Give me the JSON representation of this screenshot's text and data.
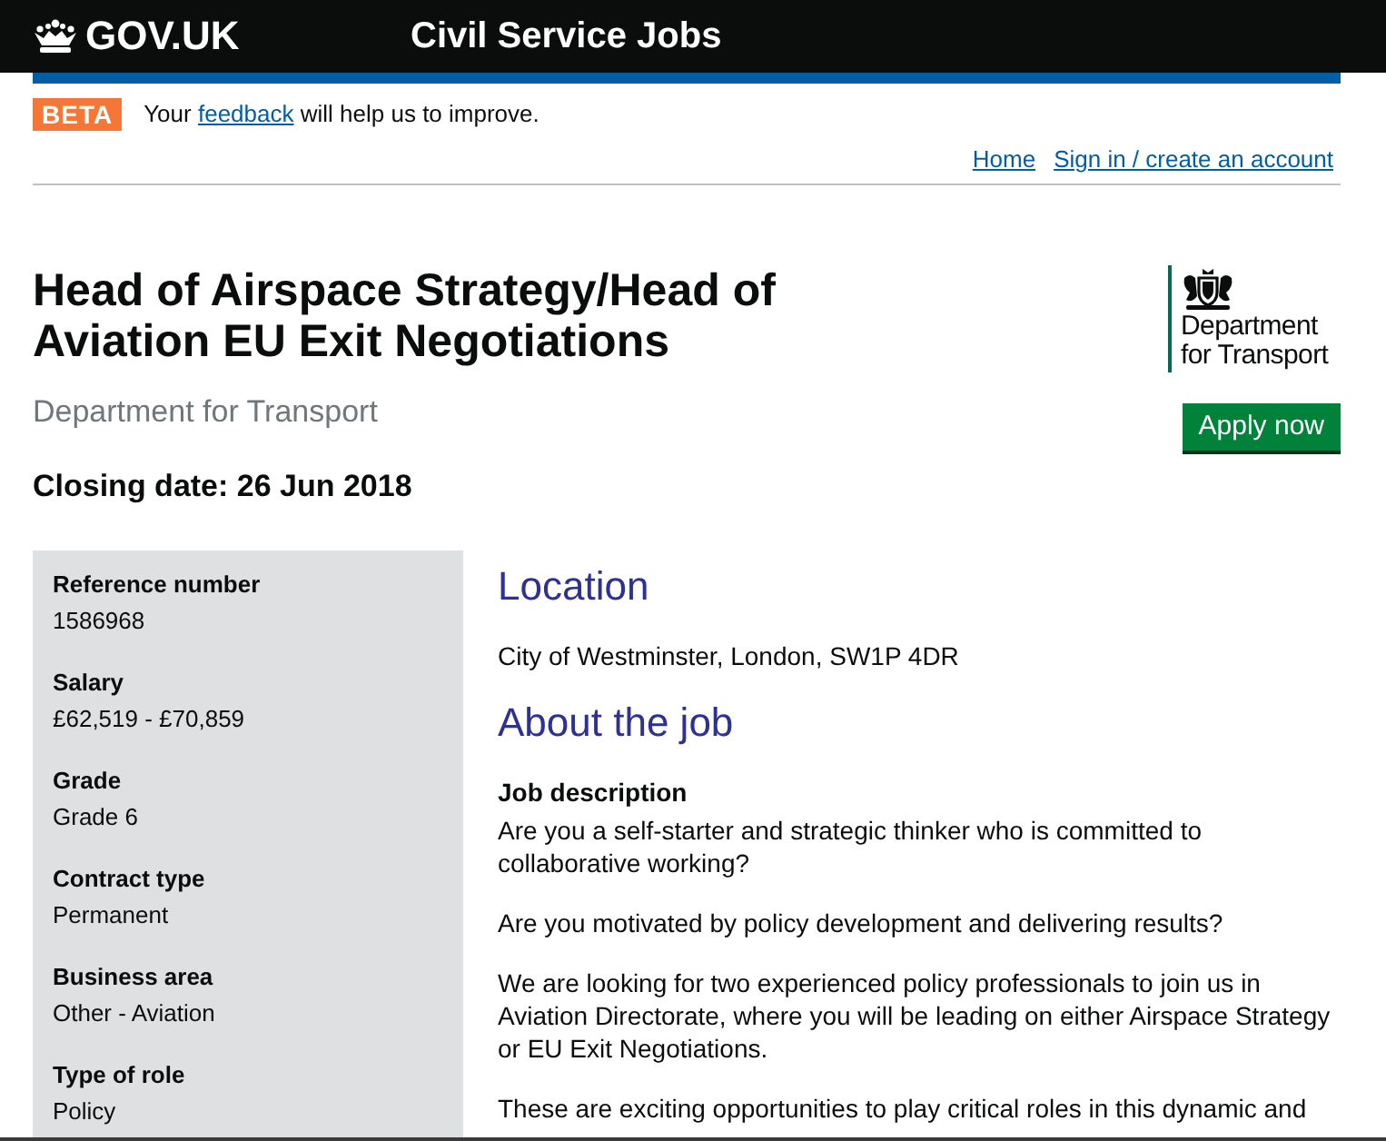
{
  "header": {
    "logo_text": "GOV.UK",
    "service_name": "Civil Service Jobs"
  },
  "phase_banner": {
    "tag": "BETA",
    "text_before": "Your",
    "link": "feedback",
    "text_after": "will help us to improve."
  },
  "nav_links": [
    {
      "label": "Home"
    },
    {
      "label": "Sign in / create an account"
    }
  ],
  "job": {
    "title": "Head of Airspace Strategy/Head of Aviation EU Exit Negotiations",
    "department": "Department for Transport",
    "closing_date": "Closing date: 26 Jun 2018"
  },
  "department_logo": {
    "lines": [
      "Department",
      "for Transport"
    ]
  },
  "apply_button": "Apply now",
  "summary": [
    {
      "label": "Reference number",
      "value": "1586968"
    },
    {
      "label": "Salary",
      "value": "£62,519 - £70,859"
    },
    {
      "label": "Grade",
      "value": "Grade 6"
    },
    {
      "label": "Contract type",
      "value": "Permanent"
    },
    {
      "label": "Business area",
      "value": "Other - Aviation"
    },
    {
      "label": "Type of role",
      "value": "Policy"
    }
  ],
  "sections": [
    {
      "heading": "Location",
      "content": [
        {
          "kind": "paragraph",
          "text": "City of Westminster, London, SW1P 4DR"
        }
      ]
    },
    {
      "heading": "About the job",
      "content": [
        {
          "kind": "subheading",
          "text": "Job description"
        },
        {
          "kind": "paragraph",
          "text": "Are you a self-starter and strategic thinker who is committed to collaborative working?"
        },
        {
          "kind": "paragraph",
          "text": "Are you motivated by policy development and delivering results?"
        },
        {
          "kind": "paragraph",
          "text": "We are looking for two experienced policy professionals to join us in Aviation Directorate, where you will be leading on either Airspace Strategy or EU Exit Negotiations."
        },
        {
          "kind": "paragraph",
          "text": "These are exciting opportunities to play critical roles in this dynamic and"
        }
      ]
    }
  ]
}
